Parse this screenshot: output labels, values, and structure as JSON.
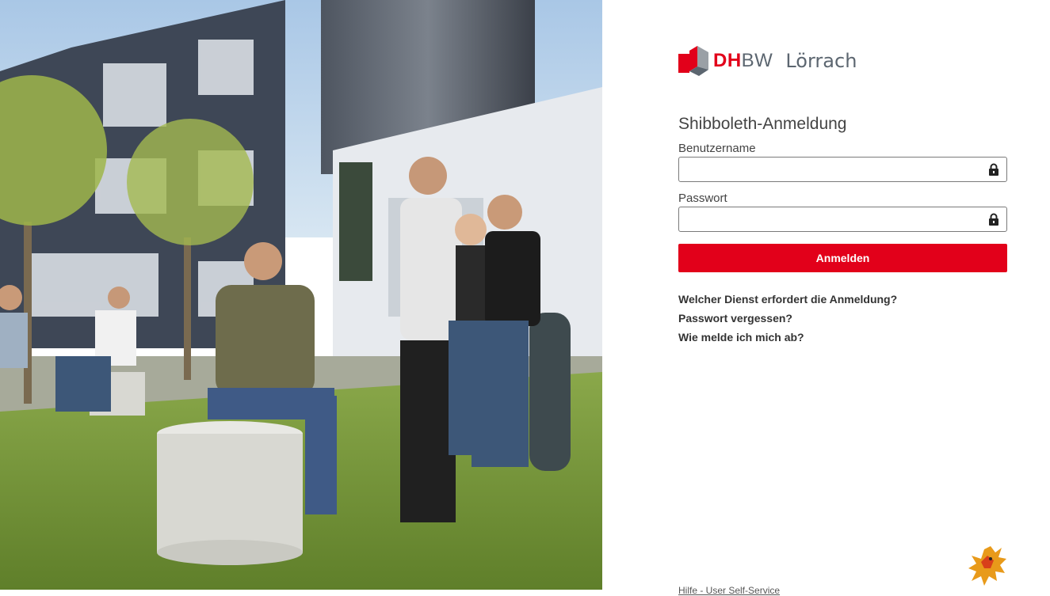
{
  "photo": {
    "alt_name": "campus-photo"
  },
  "logo": {
    "dh": "DH",
    "bw": "BW",
    "city": "Lörrach"
  },
  "login": {
    "title": "Shibboleth-Anmeldung",
    "username_label": "Benutzername",
    "password_label": "Passwort",
    "username_value": "",
    "password_value": "",
    "submit_label": "Anmelden"
  },
  "links": [
    "Welcher Dienst erfordert die Anmeldung?",
    "Passwort vergessen?",
    "Wie melde ich mich ab?"
  ],
  "footer": {
    "text": "Hilfe - User Self-Service"
  },
  "icons": {
    "username_field": "lock-icon",
    "password_field": "lock-icon",
    "footer": "griffin-logo-icon"
  },
  "colors": {
    "brand_red": "#e2001a",
    "brand_gray": "#5c6670"
  }
}
